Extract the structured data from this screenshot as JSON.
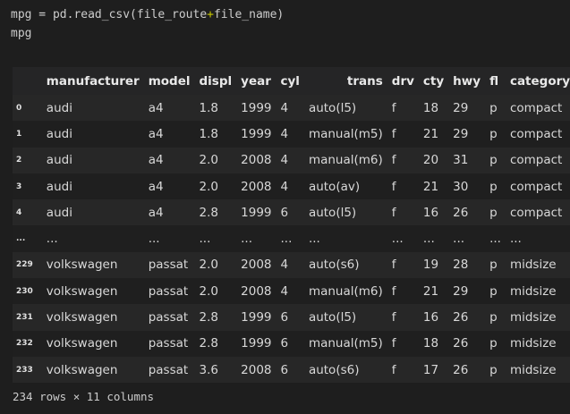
{
  "cell": {
    "line1_var": "mpg",
    "line1_eq": " = ",
    "line1_call": "pd.read_csv(file_route",
    "line1_plus": "+",
    "line1_rest": "file_name)",
    "line2": "mpg"
  },
  "table": {
    "columns": [
      "",
      "manufacturer",
      "model",
      "displ",
      "year",
      "cyl",
      "trans",
      "drv",
      "cty",
      "hwy",
      "fl",
      "category"
    ],
    "rows": [
      [
        "0",
        "audi",
        "a4",
        "1.8",
        "1999",
        "4",
        "auto(l5)",
        "f",
        "18",
        "29",
        "p",
        "compact"
      ],
      [
        "1",
        "audi",
        "a4",
        "1.8",
        "1999",
        "4",
        "manual(m5)",
        "f",
        "21",
        "29",
        "p",
        "compact"
      ],
      [
        "2",
        "audi",
        "a4",
        "2.0",
        "2008",
        "4",
        "manual(m6)",
        "f",
        "20",
        "31",
        "p",
        "compact"
      ],
      [
        "3",
        "audi",
        "a4",
        "2.0",
        "2008",
        "4",
        "auto(av)",
        "f",
        "21",
        "30",
        "p",
        "compact"
      ],
      [
        "4",
        "audi",
        "a4",
        "2.8",
        "1999",
        "6",
        "auto(l5)",
        "f",
        "16",
        "26",
        "p",
        "compact"
      ],
      [
        "...",
        "...",
        "...",
        "...",
        "...",
        "...",
        "...",
        "...",
        "...",
        "...",
        "...",
        "..."
      ],
      [
        "229",
        "volkswagen",
        "passat",
        "2.0",
        "2008",
        "4",
        "auto(s6)",
        "f",
        "19",
        "28",
        "p",
        "midsize"
      ],
      [
        "230",
        "volkswagen",
        "passat",
        "2.0",
        "2008",
        "4",
        "manual(m6)",
        "f",
        "21",
        "29",
        "p",
        "midsize"
      ],
      [
        "231",
        "volkswagen",
        "passat",
        "2.8",
        "1999",
        "6",
        "auto(l5)",
        "f",
        "16",
        "26",
        "p",
        "midsize"
      ],
      [
        "232",
        "volkswagen",
        "passat",
        "2.8",
        "1999",
        "6",
        "manual(m5)",
        "f",
        "18",
        "26",
        "p",
        "midsize"
      ],
      [
        "233",
        "volkswagen",
        "passat",
        "3.6",
        "2008",
        "6",
        "auto(s6)",
        "f",
        "17",
        "26",
        "p",
        "midsize"
      ]
    ]
  },
  "footer": "234 rows × 11 columns"
}
